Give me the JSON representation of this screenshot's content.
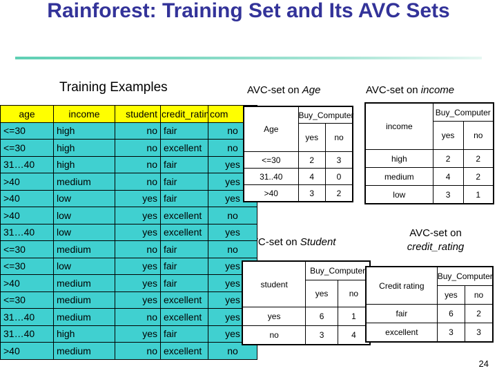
{
  "slide": {
    "title": "Rainforest:  Training Set and Its AVC Sets",
    "page_number": "24"
  },
  "captions": {
    "training": "Training Examples",
    "avc_age_prefix": "AVC-set on ",
    "avc_age_attr": "Age",
    "avc_income_prefix": "AVC-set on ",
    "avc_income_attr": "income",
    "avc_student_prefix": "AVC-set on ",
    "avc_student_attr": "Student",
    "avc_credit_prefix": "AVC-set on",
    "avc_credit_attr": "credit_rating"
  },
  "training_table": {
    "headers": [
      "age",
      "income",
      "student",
      "credit_rating",
      "com"
    ],
    "rows": [
      [
        "<=30",
        "high",
        "no",
        "fair",
        "no"
      ],
      [
        "<=30",
        "high",
        "no",
        "excellent",
        "no"
      ],
      [
        "31…40",
        "high",
        "no",
        "fair",
        "yes"
      ],
      [
        ">40",
        "medium",
        "no",
        "fair",
        "yes"
      ],
      [
        ">40",
        "low",
        "yes",
        "fair",
        "yes"
      ],
      [
        ">40",
        "low",
        "yes",
        "excellent",
        "no"
      ],
      [
        "31…40",
        "low",
        "yes",
        "excellent",
        "yes"
      ],
      [
        "<=30",
        "medium",
        "no",
        "fair",
        "no"
      ],
      [
        "<=30",
        "low",
        "yes",
        "fair",
        "yes"
      ],
      [
        ">40",
        "medium",
        "yes",
        "fair",
        "yes"
      ],
      [
        "<=30",
        "medium",
        "yes",
        "excellent",
        "yes"
      ],
      [
        "31…40",
        "medium",
        "no",
        "excellent",
        "yes"
      ],
      [
        "31…40",
        "high",
        "yes",
        "fair",
        "yes"
      ],
      [
        ">40",
        "medium",
        "no",
        "excellent",
        "no"
      ]
    ]
  },
  "avc_age": {
    "attr_label": "Age",
    "class_label": "Buy_Computer",
    "class_values": [
      "yes",
      "no"
    ],
    "rows": [
      {
        "label": "<=30",
        "yes": "2",
        "no": "3"
      },
      {
        "label": "31..40",
        "yes": "4",
        "no": "0"
      },
      {
        "label": ">40",
        "yes": "3",
        "no": "2"
      }
    ]
  },
  "avc_income": {
    "attr_label": "income",
    "class_label": "Buy_Computer",
    "class_values": [
      "yes",
      "no"
    ],
    "rows": [
      {
        "label": "high",
        "yes": "2",
        "no": "2"
      },
      {
        "label": "medium",
        "yes": "4",
        "no": "2"
      },
      {
        "label": "low",
        "yes": "3",
        "no": "1"
      }
    ]
  },
  "avc_student": {
    "attr_label": "student",
    "class_label": "Buy_Computer",
    "class_values": [
      "yes",
      "no"
    ],
    "rows": [
      {
        "label": "yes",
        "yes": "6",
        "no": "1"
      },
      {
        "label": "no",
        "yes": "3",
        "no": "4"
      }
    ]
  },
  "avc_credit": {
    "attr_label": "Credit rating",
    "class_label": "Buy_Computer",
    "class_values": [
      "yes",
      "no"
    ],
    "rows": [
      {
        "label": "fair",
        "yes": "6",
        "no": "2"
      },
      {
        "label": "excellent",
        "yes": "3",
        "no": "3"
      }
    ]
  },
  "colors": {
    "title": "#333399",
    "header_fill": "#ffff00",
    "cell_fill": "#40d0d0",
    "rule": "#5fcfb4"
  }
}
